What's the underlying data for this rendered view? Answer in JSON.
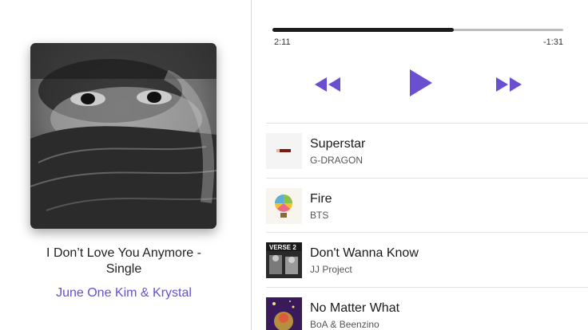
{
  "now_playing": {
    "album_title": "I Don’t Love You Anymore - Single",
    "artist": "June One Kim & Krystal",
    "elapsed": "2:11",
    "remaining": "-1:31",
    "progress": 0.624
  },
  "controls": {
    "rewind_icon": "rewind-icon",
    "play_icon": "play-icon",
    "fast_forward_icon": "fast-forward-icon",
    "accent_color": "#6a4fd1"
  },
  "tracks": [
    {
      "title": "Superstar",
      "artist": "G-DRAGON"
    },
    {
      "title": "Fire",
      "artist": "BTS"
    },
    {
      "title": "Don't Wanna Know",
      "artist": "JJ Project",
      "art_text": "VERSE 2"
    },
    {
      "title": "No Matter What",
      "artist": "BoA & Beenzino"
    }
  ]
}
